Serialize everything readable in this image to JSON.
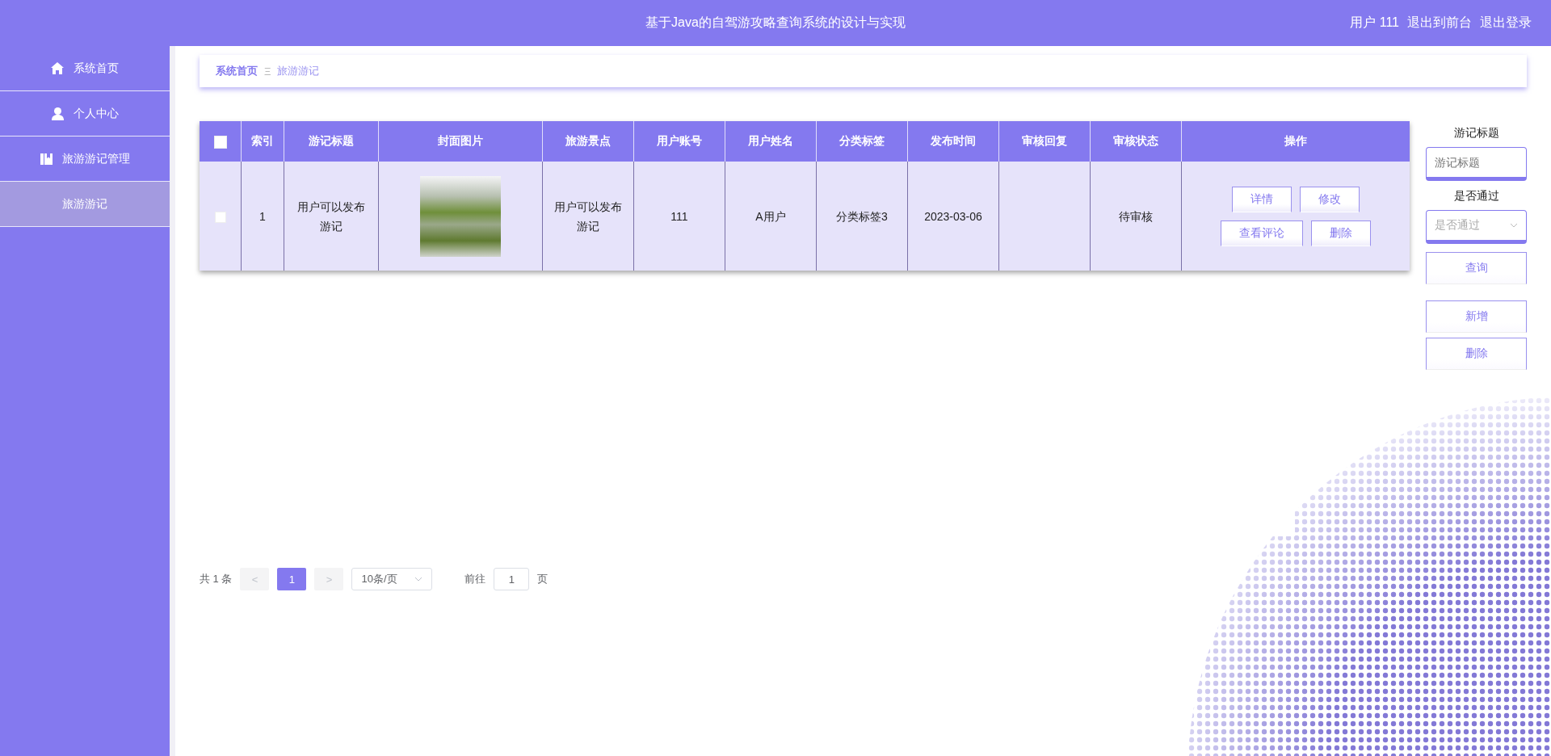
{
  "header": {
    "title": "基于Java的自驾游攻略查询系统的设计与实现",
    "user": "用户 111",
    "links": [
      "退出到前台",
      "退出登录"
    ]
  },
  "sidebar": {
    "items": [
      {
        "kind": "home",
        "label": "系统首页",
        "selected": false
      },
      {
        "kind": "person",
        "label": "个人中心",
        "selected": false
      },
      {
        "kind": "book",
        "label": "旅游游记管理",
        "selected": false,
        "children": [
          {
            "label": "旅游游记",
            "selected": true
          }
        ]
      }
    ]
  },
  "breadcrumb": {
    "items": [
      "系统首页",
      "旅游游记"
    ],
    "separator": "Ξ"
  },
  "table": {
    "select_all": {
      "checked": false
    },
    "columns": [
      "索引",
      "游记标题",
      "封面图片",
      "旅游景点",
      "用户账号",
      "用户姓名",
      "分类标签",
      "发布时间",
      "审核回复",
      "审核状态",
      "操作"
    ],
    "rows": [
      {
        "checked": false,
        "index": "1",
        "title": "用户可以发布游记",
        "spot": "用户可以发布游记",
        "account": "111",
        "user_name": "A用户",
        "category": "分类标签3",
        "published": "2023-03-06",
        "status": "待审核",
        "actions": [
          "详情",
          "修改",
          "查看评论",
          "删除"
        ]
      }
    ]
  },
  "search": {
    "title_label": "游记标题",
    "title_placeholder": "游记标题",
    "pass_label": "是否通过",
    "pass_placeholder": "是否通过",
    "buttons": [
      "查询",
      "新增",
      "删除"
    ]
  },
  "pagination": {
    "total": "共 1 条",
    "prev": "<",
    "pages": [
      {
        "label": "1",
        "selected": true
      }
    ],
    "next": ">",
    "page_size": "10条/页",
    "goto_label": "前往",
    "goto_value": "1",
    "page_unit": "页"
  }
}
